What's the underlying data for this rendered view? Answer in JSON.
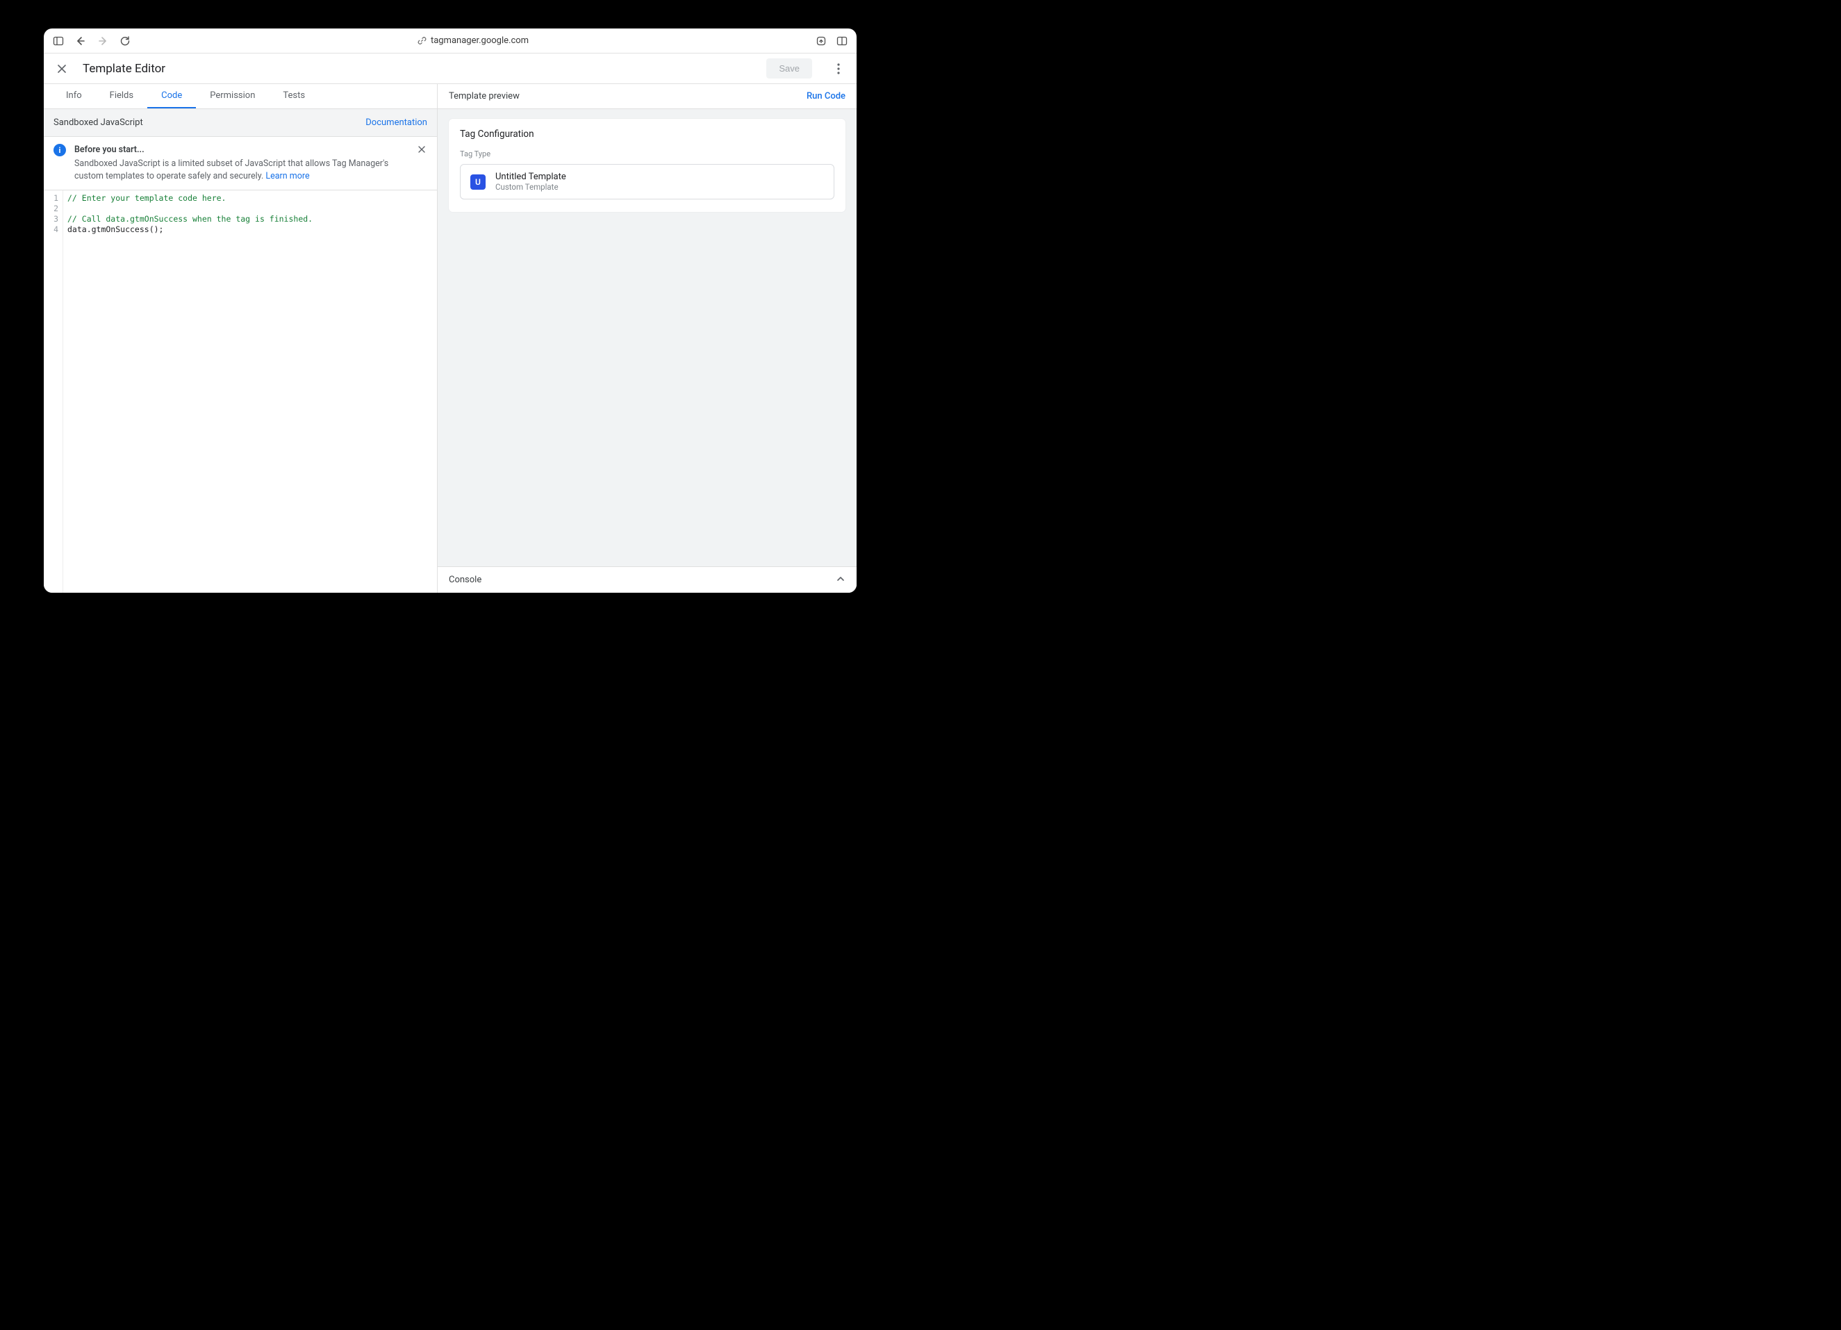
{
  "browser": {
    "url": "tagmanager.google.com"
  },
  "editor": {
    "title": "Template Editor",
    "save_label": "Save"
  },
  "tabs": {
    "info": "Info",
    "fields": "Fields",
    "code": "Code",
    "permission": "Permission",
    "tests": "Tests"
  },
  "section": {
    "title": "Sandboxed JavaScript",
    "doc_link": "Documentation"
  },
  "banner": {
    "title": "Before you start...",
    "text": "Sandboxed JavaScript is a limited subset of JavaScript that allows Tag Manager's custom templates to operate safely and securely. ",
    "learn_more": "Learn more"
  },
  "code": {
    "lines": [
      {
        "n": 1,
        "cls": "c-comment",
        "text": "// Enter your template code here."
      },
      {
        "n": 2,
        "cls": "c-code",
        "text": ""
      },
      {
        "n": 3,
        "cls": "c-comment",
        "text": "// Call data.gtmOnSuccess when the tag is finished."
      },
      {
        "n": 4,
        "cls": "c-code",
        "text": "data.gtmOnSuccess();"
      }
    ]
  },
  "preview": {
    "title": "Template preview",
    "run_code": "Run Code",
    "card_title": "Tag Configuration",
    "tag_type_label": "Tag Type",
    "tag_badge": "U",
    "tag_name": "Untitled Template",
    "tag_sub": "Custom Template"
  },
  "console": {
    "title": "Console"
  }
}
